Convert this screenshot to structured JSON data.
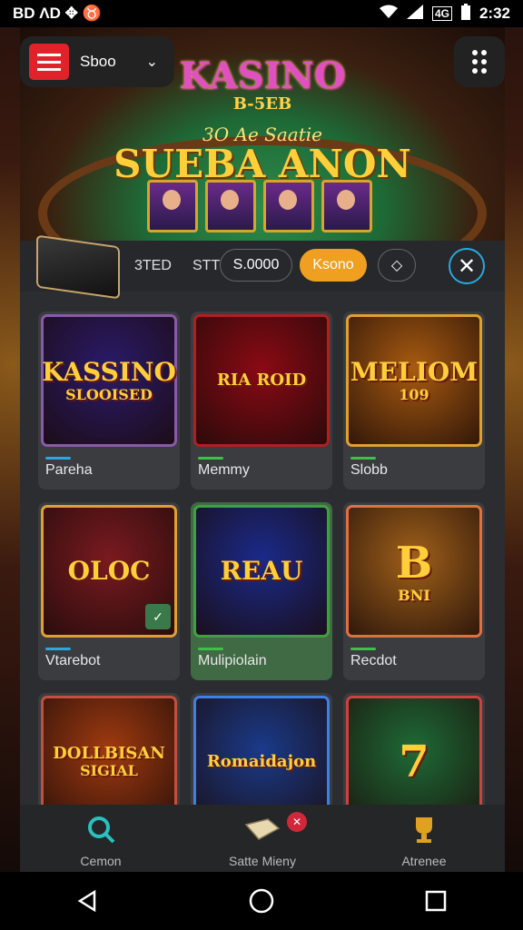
{
  "status_bar": {
    "left_icons": "BD ΛD ✥ ♉",
    "time": "2:32",
    "right_icons": [
      "wifi-icon",
      "signal-icon",
      "battery-icon"
    ],
    "lte_label": "4G"
  },
  "header": {
    "menu_label": "Sboo",
    "menu_chevron": "⌄",
    "hero": {
      "title": "KASINO",
      "subtitle": "B-5EB",
      "tagline": "3O Ae Saatie",
      "headline": "SUEBA ANON"
    }
  },
  "toolbar": {
    "wallet_label": "3TED",
    "amount_label": "STT",
    "chips": [
      "S.0000",
      "Ksono",
      "◇"
    ],
    "active_chip": "Ksono",
    "close_symbol": "✕"
  },
  "games": [
    {
      "title": "KASSINO",
      "subtitle": "SLOOISED",
      "label": "Pareha",
      "bar_color": "#2aa8e0",
      "bg": "#2a1a6a",
      "border": "#8a5aa8"
    },
    {
      "title": "RIA ROID",
      "subtitle": "",
      "label": "Memmy",
      "bar_color": "#3ec04a",
      "bg": "#8a0a14",
      "border": "#b02020"
    },
    {
      "title": "MELIOM",
      "subtitle": "109",
      "label": "Slobb",
      "bar_color": "#3ec04a",
      "bg": "#a85a10",
      "border": "#e0a030"
    },
    {
      "title": "OLOC",
      "subtitle": "",
      "label": "Vtarebot",
      "bar_color": "#2aa8e0",
      "bg": "#7a1a20",
      "border": "#e0a030"
    },
    {
      "title": "REAU",
      "subtitle": "",
      "label": "Mulipiolain",
      "bar_color": "#3ec04a",
      "bg": "#1a2a8a",
      "border": "#40a040"
    },
    {
      "title": "B",
      "subtitle": "BNI",
      "label": "Recdot",
      "bar_color": "#3ec04a",
      "bg": "#a0601a",
      "border": "#e07040"
    },
    {
      "title": "DOLLBISAN",
      "subtitle": "SIGIAL",
      "label": "",
      "bar_color": "#2aa8e0",
      "bg": "#a03a10",
      "border": "#c05040"
    },
    {
      "title": "Romaidajon",
      "subtitle": "",
      "label": "",
      "bar_color": "#2aa8e0",
      "bg": "#1a3a8a",
      "border": "#4080e0"
    },
    {
      "title": "7",
      "subtitle": "",
      "label": "",
      "bar_color": "#3ec04a",
      "bg": "#1e6a36",
      "border": "#d04040"
    }
  ],
  "bottom_nav": {
    "items": [
      {
        "label": "Cemon",
        "icon": "search-icon",
        "color": "#2ac0c0"
      },
      {
        "label": "Satte Mieny",
        "icon": "cash-icon",
        "color": "#e8d8b0"
      },
      {
        "label": "Atrenee",
        "icon": "trophy-icon",
        "color": "#e0a020"
      }
    ],
    "badge": "✕"
  },
  "colors": {
    "accent_orange": "#f0a020",
    "accent_blue": "#2aa8e0",
    "accent_green": "#3ec04a",
    "menu_red": "#e0222a"
  }
}
